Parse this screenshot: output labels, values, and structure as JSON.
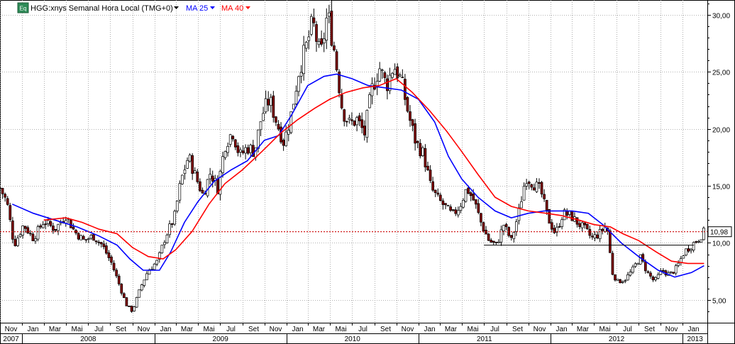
{
  "header": {
    "icon_label": "Eq",
    "instrument": "HGG:xnys Semanal Hora Local (TMG+0)",
    "ma_short": "MA 25",
    "ma_long": "MA 40"
  },
  "colors": {
    "background": "#ffffff",
    "up_candle": "#ffffff",
    "down_candle": "#800000",
    "ma_short": "#0000ff",
    "ma_long": "#ff0000",
    "price_line": "#cc0000",
    "grid": "#999999",
    "icon": "#2e8b57"
  },
  "chart_data": {
    "type": "candlestick",
    "title": "HGG:xnys Semanal Hora Local (TMG+0)",
    "ylim": [
      3,
      31.3
    ],
    "yticks": [
      5,
      10,
      15,
      20,
      25,
      30
    ],
    "ytick_labels": [
      "5,00",
      "10,00",
      "15,00",
      "20,00",
      "25,00",
      "30,00"
    ],
    "xlim": [
      "2007-11-01",
      "2013-03-10"
    ],
    "month_ticks": [
      {
        "date": "2007-11-01",
        "label": "Nov"
      },
      {
        "date": "2008-01-01",
        "label": "Jan"
      },
      {
        "date": "2008-03-01",
        "label": "Mar"
      },
      {
        "date": "2008-05-01",
        "label": "Mai"
      },
      {
        "date": "2008-07-01",
        "label": "Jul"
      },
      {
        "date": "2008-09-01",
        "label": "Set"
      },
      {
        "date": "2008-11-01",
        "label": "Nov"
      },
      {
        "date": "2009-01-01",
        "label": "Jan"
      },
      {
        "date": "2009-03-01",
        "label": "Mar"
      },
      {
        "date": "2009-05-01",
        "label": "Mai"
      },
      {
        "date": "2009-07-01",
        "label": "Jul"
      },
      {
        "date": "2009-09-01",
        "label": "Set"
      },
      {
        "date": "2009-11-01",
        "label": "Nov"
      },
      {
        "date": "2010-01-01",
        "label": "Jan"
      },
      {
        "date": "2010-03-01",
        "label": "Mar"
      },
      {
        "date": "2010-05-01",
        "label": "Mai"
      },
      {
        "date": "2010-07-01",
        "label": "Jul"
      },
      {
        "date": "2010-09-01",
        "label": "Set"
      },
      {
        "date": "2010-11-01",
        "label": "Nov"
      },
      {
        "date": "2011-01-01",
        "label": "Jan"
      },
      {
        "date": "2011-03-01",
        "label": "Mar"
      },
      {
        "date": "2011-05-01",
        "label": "Mai"
      },
      {
        "date": "2011-07-01",
        "label": "Jul"
      },
      {
        "date": "2011-09-01",
        "label": "Set"
      },
      {
        "date": "2011-11-01",
        "label": "Nov"
      },
      {
        "date": "2012-01-01",
        "label": "Jan"
      },
      {
        "date": "2012-03-01",
        "label": "Mar"
      },
      {
        "date": "2012-05-01",
        "label": "Mai"
      },
      {
        "date": "2012-07-01",
        "label": "Jul"
      },
      {
        "date": "2012-09-01",
        "label": "Set"
      },
      {
        "date": "2012-11-01",
        "label": "Nov"
      },
      {
        "date": "2013-01-01",
        "label": "Jan"
      }
    ],
    "year_ticks": [
      {
        "start": "2007-11-01",
        "end": "2008-01-01",
        "label": "2007"
      },
      {
        "start": "2008-01-01",
        "end": "2009-01-01",
        "label": "2008"
      },
      {
        "start": "2009-01-01",
        "end": "2010-01-01",
        "label": "2009"
      },
      {
        "start": "2010-01-01",
        "end": "2011-01-01",
        "label": "2010"
      },
      {
        "start": "2011-01-01",
        "end": "2012-01-01",
        "label": "2011"
      },
      {
        "start": "2012-01-01",
        "end": "2013-01-01",
        "label": "2012"
      },
      {
        "start": "2013-01-01",
        "end": "2013-03-10",
        "label": "2013"
      }
    ],
    "last_price": 10.98,
    "last_price_label": "10,98",
    "support_line": {
      "start": "2011-07-01",
      "end": "2013-02-01",
      "value": 9.8
    },
    "price_path": [
      [
        "2007-11-01",
        14.8
      ],
      [
        "2007-11-20",
        13.6
      ],
      [
        "2007-12-10",
        9.8
      ],
      [
        "2008-01-05",
        11.6
      ],
      [
        "2008-02-01",
        10.4
      ],
      [
        "2008-03-01",
        11.9
      ],
      [
        "2008-04-01",
        11.2
      ],
      [
        "2008-05-01",
        12.4
      ],
      [
        "2008-05-25",
        11.0
      ],
      [
        "2008-06-20",
        10.2
      ],
      [
        "2008-07-15",
        10.6
      ],
      [
        "2008-08-10",
        9.8
      ],
      [
        "2008-09-05",
        8.2
      ],
      [
        "2008-09-25",
        6.4
      ],
      [
        "2008-10-15",
        4.6
      ],
      [
        "2008-11-01",
        4.0
      ],
      [
        "2008-11-25",
        6.2
      ],
      [
        "2008-12-15",
        7.6
      ],
      [
        "2009-01-10",
        8.4
      ],
      [
        "2009-02-01",
        10.6
      ],
      [
        "2009-02-25",
        12.2
      ],
      [
        "2009-03-15",
        15.4
      ],
      [
        "2009-04-05",
        17.6
      ],
      [
        "2009-04-25",
        15.8
      ],
      [
        "2009-05-15",
        14.2
      ],
      [
        "2009-06-05",
        16.2
      ],
      [
        "2009-06-25",
        14.8
      ],
      [
        "2009-07-15",
        18.6
      ],
      [
        "2009-08-05",
        19.8
      ],
      [
        "2009-08-25",
        17.6
      ],
      [
        "2009-09-15",
        18.4
      ],
      [
        "2009-10-05",
        18.0
      ],
      [
        "2009-10-25",
        21.2
      ],
      [
        "2009-11-15",
        22.6
      ],
      [
        "2009-12-05",
        20.6
      ],
      [
        "2009-12-25",
        18.8
      ],
      [
        "2010-01-15",
        21.4
      ],
      [
        "2010-02-05",
        25.2
      ],
      [
        "2010-02-25",
        27.2
      ],
      [
        "2010-03-15",
        29.4
      ],
      [
        "2010-04-05",
        26.2
      ],
      [
        "2010-04-25",
        30.2
      ],
      [
        "2010-05-15",
        26.6
      ],
      [
        "2010-06-05",
        21.6
      ],
      [
        "2010-06-25",
        20.4
      ],
      [
        "2010-07-15",
        20.8
      ],
      [
        "2010-08-05",
        19.6
      ],
      [
        "2010-08-25",
        23.4
      ],
      [
        "2010-09-15",
        25.4
      ],
      [
        "2010-10-05",
        23.8
      ],
      [
        "2010-10-25",
        25.6
      ],
      [
        "2010-11-15",
        24.2
      ],
      [
        "2010-12-05",
        21.2
      ],
      [
        "2010-12-25",
        18.8
      ],
      [
        "2011-01-15",
        17.8
      ],
      [
        "2011-02-05",
        14.8
      ],
      [
        "2011-02-25",
        13.8
      ],
      [
        "2011-03-15",
        13.2
      ],
      [
        "2011-04-05",
        12.4
      ],
      [
        "2011-04-25",
        13.2
      ],
      [
        "2011-05-15",
        14.8
      ],
      [
        "2011-06-05",
        13.6
      ],
      [
        "2011-06-25",
        11.6
      ],
      [
        "2011-07-15",
        10.2
      ],
      [
        "2011-08-05",
        9.8
      ],
      [
        "2011-08-25",
        11.6
      ],
      [
        "2011-09-15",
        10.2
      ],
      [
        "2011-10-05",
        12.6
      ],
      [
        "2011-10-25",
        15.8
      ],
      [
        "2011-11-15",
        15.2
      ],
      [
        "2011-12-05",
        14.6
      ],
      [
        "2011-12-25",
        12.2
      ],
      [
        "2012-01-15",
        10.8
      ],
      [
        "2012-02-05",
        12.6
      ],
      [
        "2012-02-25",
        12.4
      ],
      [
        "2012-03-15",
        11.8
      ],
      [
        "2012-04-05",
        11.2
      ],
      [
        "2012-04-25",
        10.4
      ],
      [
        "2012-05-15",
        10.8
      ],
      [
        "2012-06-05",
        11.6
      ],
      [
        "2012-06-20",
        7.4
      ],
      [
        "2012-07-05",
        6.6
      ],
      [
        "2012-07-25",
        6.8
      ],
      [
        "2012-08-15",
        7.6
      ],
      [
        "2012-09-05",
        8.8
      ],
      [
        "2012-09-25",
        7.4
      ],
      [
        "2012-10-15",
        6.6
      ],
      [
        "2012-11-05",
        7.6
      ],
      [
        "2012-11-25",
        7.2
      ],
      [
        "2012-12-15",
        7.8
      ],
      [
        "2013-01-05",
        9.2
      ],
      [
        "2013-01-25",
        9.8
      ],
      [
        "2013-02-15",
        10.4
      ],
      [
        "2013-03-01",
        10.98
      ]
    ],
    "series": [
      {
        "name": "MA 25",
        "color": "#0000ff",
        "points": [
          [
            "2007-12-05",
            13.4
          ],
          [
            "2008-02-01",
            12.6
          ],
          [
            "2008-04-01",
            12.0
          ],
          [
            "2008-06-01",
            11.4
          ],
          [
            "2008-08-01",
            10.6
          ],
          [
            "2008-09-20",
            9.8
          ],
          [
            "2008-10-25",
            8.6
          ],
          [
            "2008-12-01",
            7.6
          ],
          [
            "2009-01-15",
            7.6
          ],
          [
            "2009-02-15",
            9.2
          ],
          [
            "2009-03-25",
            11.8
          ],
          [
            "2009-05-01",
            13.6
          ],
          [
            "2009-06-15",
            15.4
          ],
          [
            "2009-08-01",
            16.4
          ],
          [
            "2009-09-15",
            17.2
          ],
          [
            "2009-11-01",
            19.0
          ],
          [
            "2009-12-10",
            19.4
          ],
          [
            "2010-01-15",
            21.2
          ],
          [
            "2010-03-01",
            23.8
          ],
          [
            "2010-04-15",
            24.6
          ],
          [
            "2010-05-20",
            24.8
          ],
          [
            "2010-07-01",
            24.4
          ],
          [
            "2010-08-15",
            23.8
          ],
          [
            "2010-10-01",
            23.6
          ],
          [
            "2010-11-15",
            23.4
          ],
          [
            "2011-01-01",
            22.6
          ],
          [
            "2011-02-15",
            20.6
          ],
          [
            "2011-03-25",
            17.6
          ],
          [
            "2011-05-01",
            15.6
          ],
          [
            "2011-06-15",
            14.0
          ],
          [
            "2011-08-01",
            12.8
          ],
          [
            "2011-09-15",
            12.2
          ],
          [
            "2011-11-01",
            12.6
          ],
          [
            "2011-12-15",
            12.8
          ],
          [
            "2012-01-20",
            12.8
          ],
          [
            "2012-03-01",
            12.8
          ],
          [
            "2012-04-15",
            12.6
          ],
          [
            "2012-05-25",
            11.6
          ],
          [
            "2012-07-15",
            10.0
          ],
          [
            "2012-09-01",
            8.8
          ],
          [
            "2012-10-25",
            7.6
          ],
          [
            "2012-12-10",
            7.0
          ],
          [
            "2013-01-25",
            7.4
          ],
          [
            "2013-03-01",
            8.0
          ]
        ]
      },
      {
        "name": "MA 40",
        "color": "#ff0000",
        "points": [
          [
            "2008-03-01",
            12.0
          ],
          [
            "2008-05-01",
            12.2
          ],
          [
            "2008-06-15",
            11.8
          ],
          [
            "2008-08-01",
            11.2
          ],
          [
            "2008-09-20",
            10.8
          ],
          [
            "2008-11-01",
            9.6
          ],
          [
            "2008-12-15",
            8.8
          ],
          [
            "2009-01-25",
            8.6
          ],
          [
            "2009-03-01",
            9.4
          ],
          [
            "2009-04-15",
            11.0
          ],
          [
            "2009-06-01",
            13.4
          ],
          [
            "2009-07-15",
            15.2
          ],
          [
            "2009-09-01",
            16.4
          ],
          [
            "2009-10-25",
            18.0
          ],
          [
            "2009-12-15",
            19.6
          ],
          [
            "2010-02-01",
            20.8
          ],
          [
            "2010-03-20",
            21.8
          ],
          [
            "2010-05-01",
            22.6
          ],
          [
            "2010-06-15",
            23.2
          ],
          [
            "2010-08-01",
            23.6
          ],
          [
            "2010-09-15",
            23.8
          ],
          [
            "2010-11-01",
            24.4
          ],
          [
            "2010-12-15",
            23.2
          ],
          [
            "2011-02-01",
            21.6
          ],
          [
            "2011-03-20",
            19.8
          ],
          [
            "2011-05-01",
            18.0
          ],
          [
            "2011-06-15",
            16.0
          ],
          [
            "2011-08-01",
            14.0
          ],
          [
            "2011-09-15",
            13.2
          ],
          [
            "2011-11-01",
            12.8
          ],
          [
            "2011-12-20",
            12.6
          ],
          [
            "2012-02-01",
            12.4
          ],
          [
            "2012-03-20",
            12.0
          ],
          [
            "2012-05-01",
            11.6
          ],
          [
            "2012-06-15",
            11.4
          ],
          [
            "2012-07-20",
            10.8
          ],
          [
            "2012-09-01",
            10.2
          ],
          [
            "2012-10-20",
            9.2
          ],
          [
            "2012-12-01",
            8.4
          ],
          [
            "2013-01-15",
            8.2
          ],
          [
            "2013-03-01",
            8.2
          ]
        ]
      }
    ]
  }
}
